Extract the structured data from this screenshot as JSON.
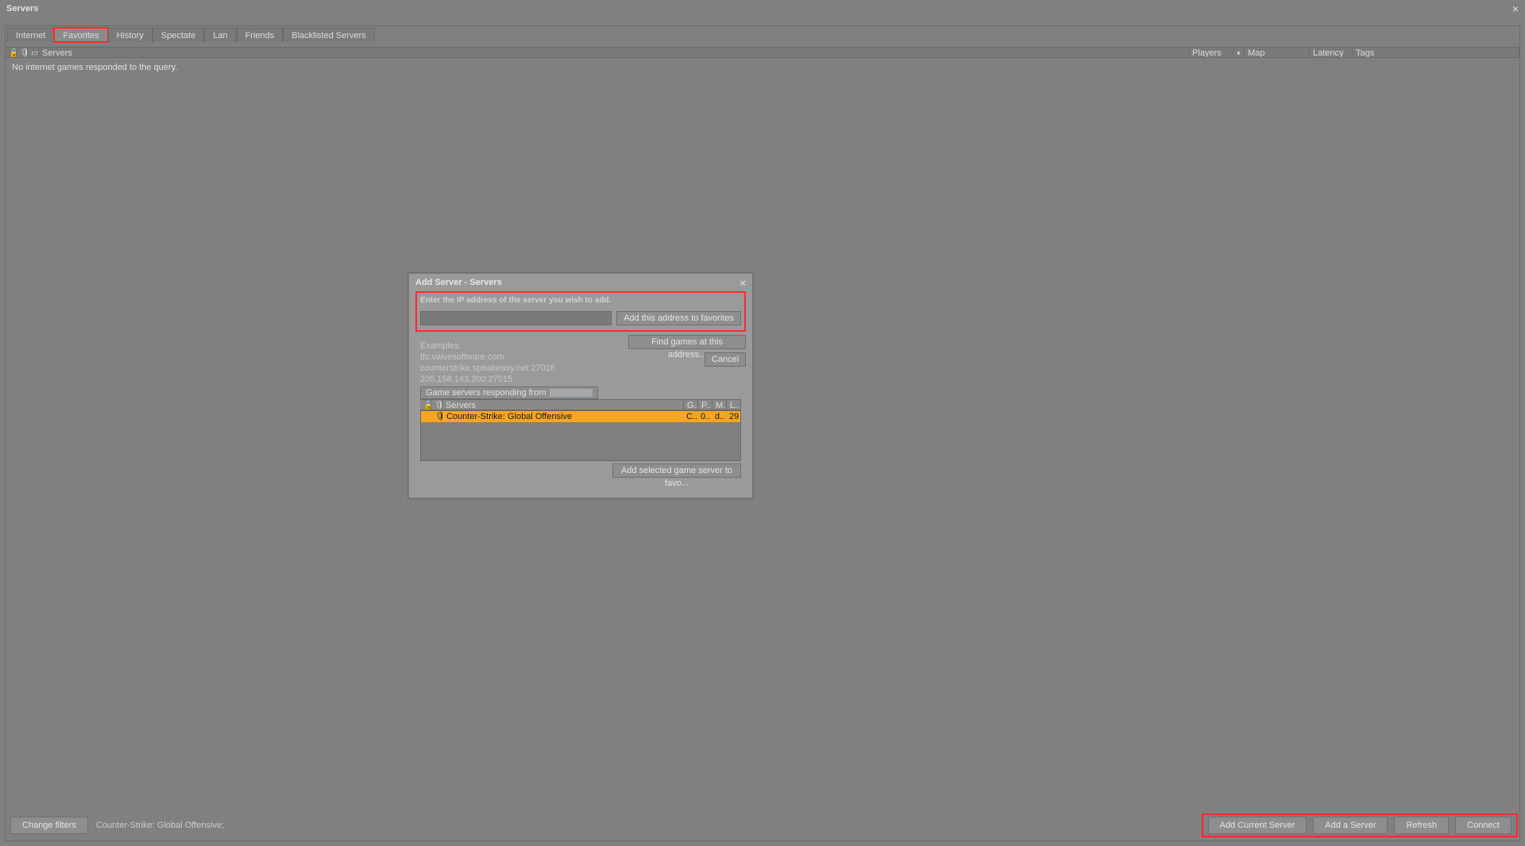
{
  "window": {
    "title": "Servers"
  },
  "tabs": {
    "internet": "Internet",
    "favorites": "Favorites",
    "history": "History",
    "spectate": "Spectate",
    "lan": "Lan",
    "friends": "Friends",
    "blacklisted": "Blacklisted Servers"
  },
  "columns": {
    "servers": "Servers",
    "players": "Players",
    "map": "Map",
    "latency": "Latency",
    "tags": "Tags"
  },
  "list": {
    "empty_message": "No internet games responded to the query."
  },
  "bottom": {
    "change_filters": "Change filters",
    "game_label": "Counter-Strike: Global Offensive;",
    "add_current": "Add Current Server",
    "add_server": "Add a Server",
    "refresh": "Refresh",
    "connect": "Connect"
  },
  "modal": {
    "title": "Add Server - Servers",
    "prompt": "Enter the IP address of the server you wish to add.",
    "ip_value": "",
    "add_fav": "Add this address to favorites",
    "find": "Find games at this address...",
    "cancel": "Cancel",
    "examples_label": "Examples:",
    "ex1": "tfc.valvesoftware.com",
    "ex2": "counterstrike.speakeasy.net:27016",
    "ex3": "205.158.143.200:27015",
    "responding_label": "Game servers responding from",
    "mini_cols": {
      "servers": "Servers",
      "g": "G...",
      "p": "P...",
      "m": "M...",
      "l": "L..."
    },
    "mini_row": {
      "name": "Counter-Strike: Global Offensive",
      "g": "C...",
      "p": "0...",
      "m": "d...",
      "l": "29"
    },
    "add_selected": "Add selected game server to favo..."
  }
}
